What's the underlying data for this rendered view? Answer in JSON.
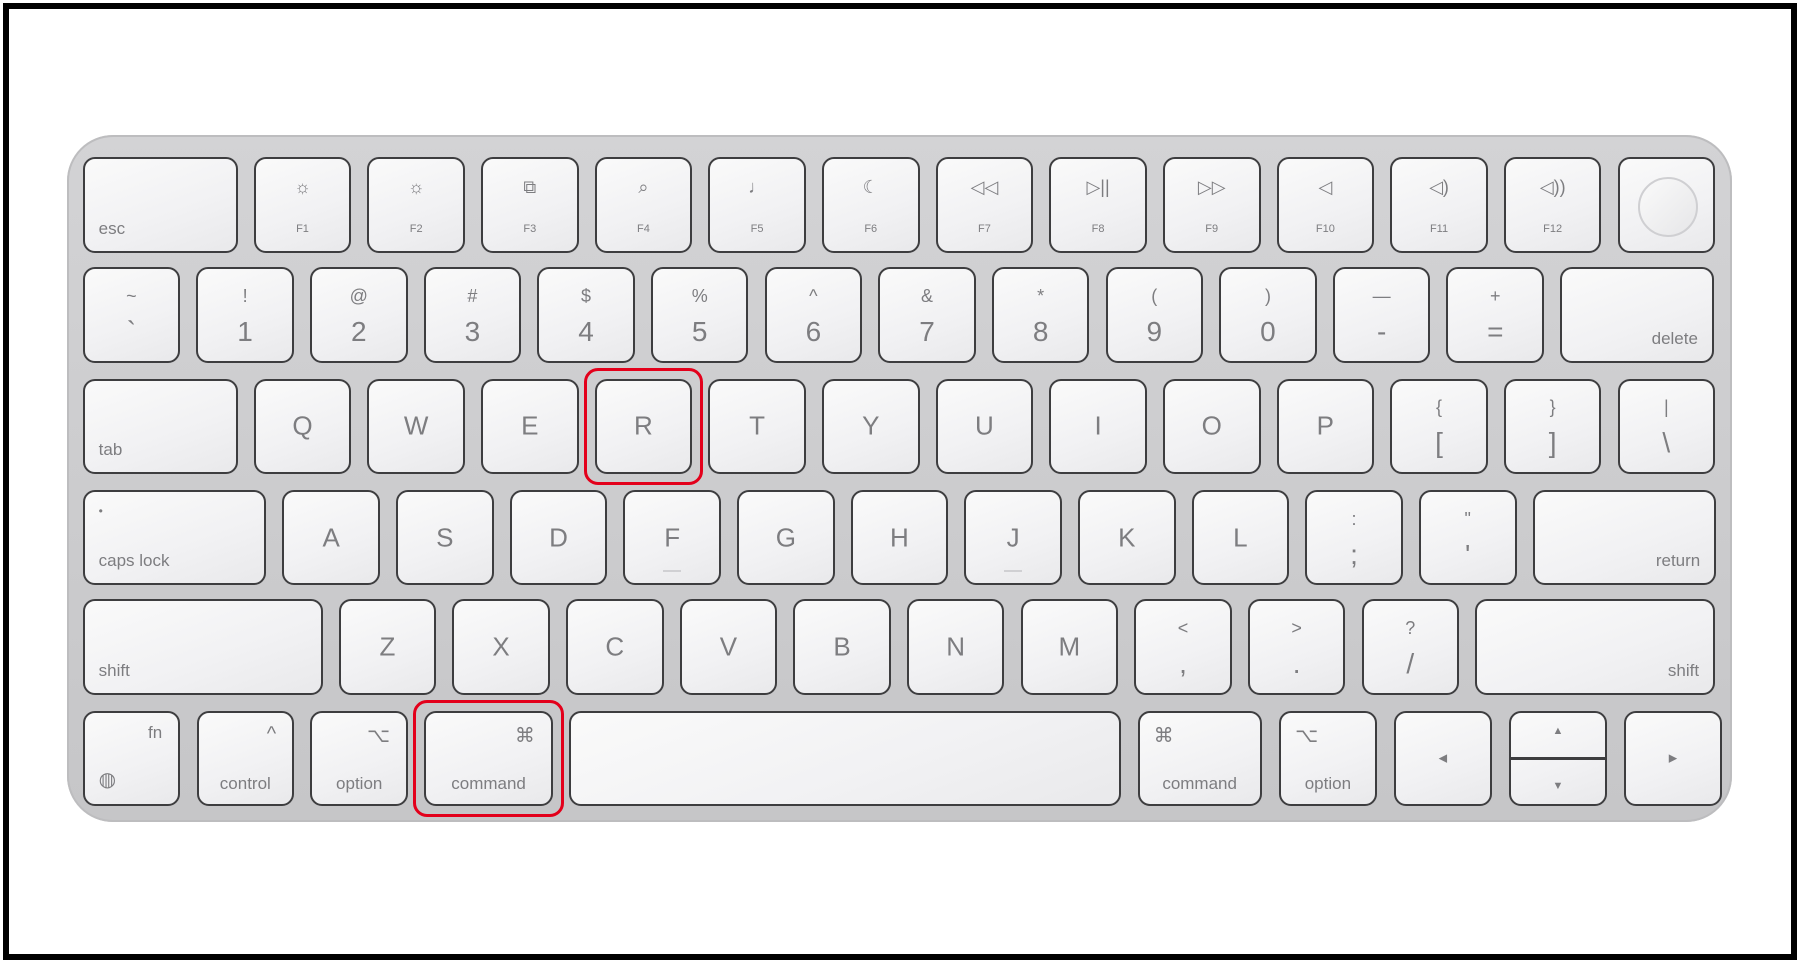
{
  "keyboard": {
    "rows": [
      [
        {
          "id": "esc",
          "label": "esc"
        },
        {
          "id": "f1",
          "icon": "brightness-down-icon",
          "label": "F1"
        },
        {
          "id": "f2",
          "icon": "brightness-up-icon",
          "label": "F2"
        },
        {
          "id": "f3",
          "icon": "mission-control-icon",
          "label": "F3"
        },
        {
          "id": "f4",
          "icon": "search-icon",
          "label": "F4"
        },
        {
          "id": "f5",
          "icon": "microphone-icon",
          "label": "F5"
        },
        {
          "id": "f6",
          "icon": "moon-icon",
          "label": "F6"
        },
        {
          "id": "f7",
          "icon": "rewind-icon",
          "label": "F7"
        },
        {
          "id": "f8",
          "icon": "play-pause-icon",
          "label": "F8"
        },
        {
          "id": "f9",
          "icon": "fast-forward-icon",
          "label": "F9"
        },
        {
          "id": "f10",
          "icon": "mute-icon",
          "label": "F10"
        },
        {
          "id": "f11",
          "icon": "volume-down-icon",
          "label": "F11"
        },
        {
          "id": "f12",
          "icon": "volume-up-icon",
          "label": "F12"
        },
        {
          "id": "touch-id",
          "icon": "touch-id-icon"
        }
      ],
      [
        {
          "id": "backtick",
          "top": "~",
          "bottom": "`"
        },
        {
          "id": "1",
          "top": "!",
          "bottom": "1"
        },
        {
          "id": "2",
          "top": "@",
          "bottom": "2"
        },
        {
          "id": "3",
          "top": "#",
          "bottom": "3"
        },
        {
          "id": "4",
          "top": "$",
          "bottom": "4"
        },
        {
          "id": "5",
          "top": "%",
          "bottom": "5"
        },
        {
          "id": "6",
          "top": "^",
          "bottom": "6"
        },
        {
          "id": "7",
          "top": "&",
          "bottom": "7"
        },
        {
          "id": "8",
          "top": "*",
          "bottom": "8"
        },
        {
          "id": "9",
          "top": "(",
          "bottom": "9"
        },
        {
          "id": "0",
          "top": ")",
          "bottom": "0"
        },
        {
          "id": "minus",
          "top": "—",
          "bottom": "-"
        },
        {
          "id": "equals",
          "top": "+",
          "bottom": "="
        },
        {
          "id": "delete",
          "label": "delete"
        }
      ],
      [
        {
          "id": "tab",
          "label": "tab"
        },
        {
          "id": "q",
          "main": "Q"
        },
        {
          "id": "w",
          "main": "W"
        },
        {
          "id": "e",
          "main": "E"
        },
        {
          "id": "r",
          "main": "R"
        },
        {
          "id": "t",
          "main": "T"
        },
        {
          "id": "y",
          "main": "Y"
        },
        {
          "id": "u",
          "main": "U"
        },
        {
          "id": "i",
          "main": "I"
        },
        {
          "id": "o",
          "main": "O"
        },
        {
          "id": "p",
          "main": "P"
        },
        {
          "id": "open-bracket",
          "top": "{",
          "bottom": "["
        },
        {
          "id": "close-bracket",
          "top": "}",
          "bottom": "]"
        },
        {
          "id": "backslash",
          "top": "|",
          "bottom": "\\"
        }
      ],
      [
        {
          "id": "caps-lock",
          "label": "caps lock",
          "glyph": "•"
        },
        {
          "id": "a",
          "main": "A"
        },
        {
          "id": "s",
          "main": "S"
        },
        {
          "id": "d",
          "main": "D"
        },
        {
          "id": "f",
          "main": "F"
        },
        {
          "id": "g",
          "main": "G"
        },
        {
          "id": "h",
          "main": "H"
        },
        {
          "id": "j",
          "main": "J"
        },
        {
          "id": "k",
          "main": "K"
        },
        {
          "id": "l",
          "main": "L"
        },
        {
          "id": "semicolon",
          "top": ":",
          "bottom": ";"
        },
        {
          "id": "quote",
          "top": "\"",
          "bottom": "'"
        },
        {
          "id": "return",
          "label": "return"
        }
      ],
      [
        {
          "id": "shift-left",
          "label": "shift"
        },
        {
          "id": "z",
          "main": "Z"
        },
        {
          "id": "x",
          "main": "X"
        },
        {
          "id": "c",
          "main": "C"
        },
        {
          "id": "v",
          "main": "V"
        },
        {
          "id": "b",
          "main": "B"
        },
        {
          "id": "n",
          "main": "N"
        },
        {
          "id": "m",
          "main": "M"
        },
        {
          "id": "comma",
          "top": "<",
          "bottom": ","
        },
        {
          "id": "period",
          "top": ">",
          "bottom": "."
        },
        {
          "id": "slash",
          "top": "?",
          "bottom": "/"
        },
        {
          "id": "shift-right",
          "label": "shift"
        }
      ],
      [
        {
          "id": "fn",
          "label": "fn",
          "icon": "globe-icon",
          "glyph": "🌐"
        },
        {
          "id": "control",
          "label": "control",
          "glyph": "^"
        },
        {
          "id": "option-left",
          "label": "option",
          "glyph": "⌥"
        },
        {
          "id": "command-left",
          "label": "command",
          "glyph": "⌘"
        },
        {
          "id": "space"
        },
        {
          "id": "command-right",
          "label": "command",
          "glyph": "⌘"
        },
        {
          "id": "option-right",
          "label": "option",
          "glyph": "⌥"
        },
        {
          "id": "arrow-left",
          "glyph": "◀"
        },
        {
          "id": "arrow-up-down",
          "glyph": "▲",
          "glyph2": "▼"
        },
        {
          "id": "arrow-right",
          "glyph": "▶"
        }
      ]
    ]
  },
  "highlighted_keys": [
    "r",
    "command-left"
  ],
  "colors": {
    "highlight": "#e3001b",
    "key_outline": "#3d3d3f",
    "key_text": "#7d7d80",
    "body": "#c9c9cb"
  }
}
